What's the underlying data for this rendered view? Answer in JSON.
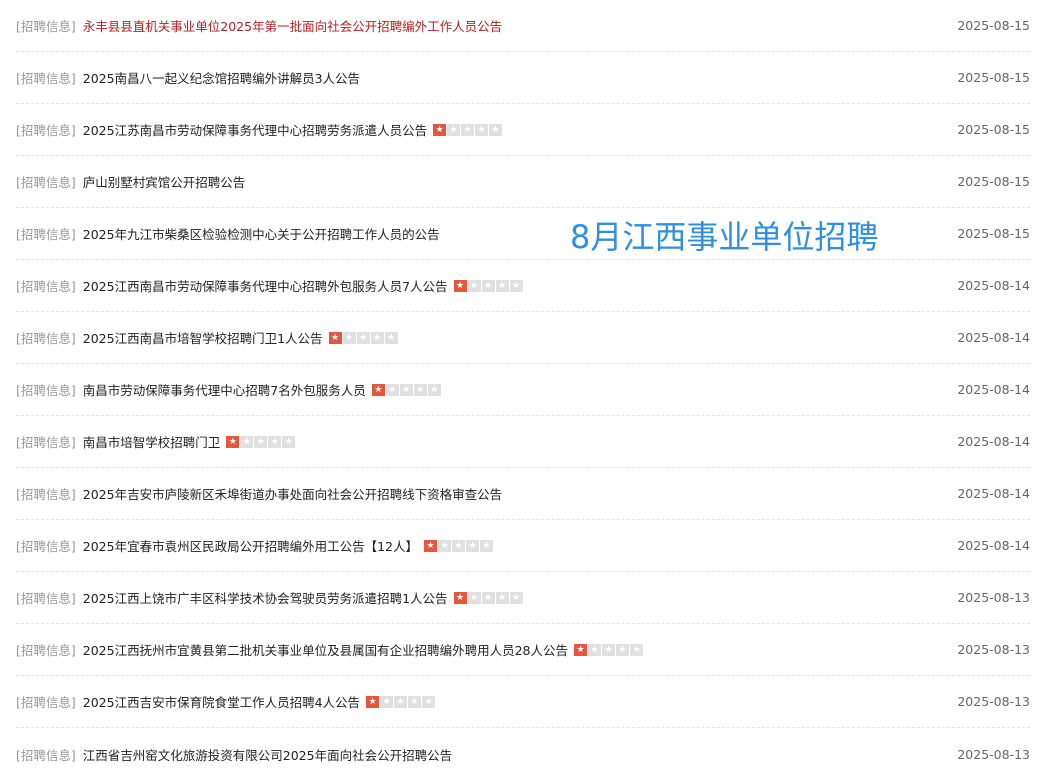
{
  "overlay_text": "8月江西事业单位招聘",
  "colors": {
    "highlight_title": "#b22222",
    "star_on": "#e8553e",
    "star_off": "#e0e0e0",
    "overlay": "#2f8fe0"
  },
  "items": [
    {
      "tag": "[招聘信息]",
      "title": "永丰县县直机关事业单位2025年第一批面向社会公开招聘编外工作人员公告",
      "date": "2025-08-15",
      "rating": null,
      "highlight": true
    },
    {
      "tag": "[招聘信息]",
      "title": "2025南昌八一起义纪念馆招聘编外讲解员3人公告",
      "date": "2025-08-15",
      "rating": null,
      "highlight": false
    },
    {
      "tag": "[招聘信息]",
      "title": "2025江苏南昌市劳动保障事务代理中心招聘劳务派遣人员公告",
      "date": "2025-08-15",
      "rating": 1,
      "highlight": false
    },
    {
      "tag": "[招聘信息]",
      "title": "庐山别墅村宾馆公开招聘公告",
      "date": "2025-08-15",
      "rating": null,
      "highlight": false
    },
    {
      "tag": "[招聘信息]",
      "title": "2025年九江市柴桑区检验检测中心关于公开招聘工作人员的公告",
      "date": "2025-08-15",
      "rating": null,
      "highlight": false
    },
    {
      "tag": "[招聘信息]",
      "title": "2025江西南昌市劳动保障事务代理中心招聘外包服务人员7人公告",
      "date": "2025-08-14",
      "rating": 1,
      "highlight": false
    },
    {
      "tag": "[招聘信息]",
      "title": "2025江西南昌市培智学校招聘门卫1人公告",
      "date": "2025-08-14",
      "rating": 1,
      "highlight": false
    },
    {
      "tag": "[招聘信息]",
      "title": "南昌市劳动保障事务代理中心招聘7名外包服务人员",
      "date": "2025-08-14",
      "rating": 1,
      "highlight": false
    },
    {
      "tag": "[招聘信息]",
      "title": "南昌市培智学校招聘门卫",
      "date": "2025-08-14",
      "rating": 1,
      "highlight": false
    },
    {
      "tag": "[招聘信息]",
      "title": "2025年吉安市庐陵新区禾埠街道办事处面向社会公开招聘线下资格审查公告",
      "date": "2025-08-14",
      "rating": null,
      "highlight": false
    },
    {
      "tag": "[招聘信息]",
      "title": "2025年宜春市袁州区民政局公开招聘编外用工公告【12人】",
      "date": "2025-08-14",
      "rating": 1,
      "highlight": false
    },
    {
      "tag": "[招聘信息]",
      "title": "2025江西上饶市广丰区科学技术协会驾驶员劳务派遣招聘1人公告",
      "date": "2025-08-13",
      "rating": 1,
      "highlight": false
    },
    {
      "tag": "[招聘信息]",
      "title": "2025江西抚州市宜黄县第二批机关事业单位及县属国有企业招聘编外聘用人员28人公告",
      "date": "2025-08-13",
      "rating": 1,
      "highlight": false
    },
    {
      "tag": "[招聘信息]",
      "title": "2025江西吉安市保育院食堂工作人员招聘4人公告",
      "date": "2025-08-13",
      "rating": 1,
      "highlight": false
    },
    {
      "tag": "[招聘信息]",
      "title": "江西省吉州窑文化旅游投资有限公司2025年面向社会公开招聘公告",
      "date": "2025-08-13",
      "rating": null,
      "highlight": false
    }
  ]
}
